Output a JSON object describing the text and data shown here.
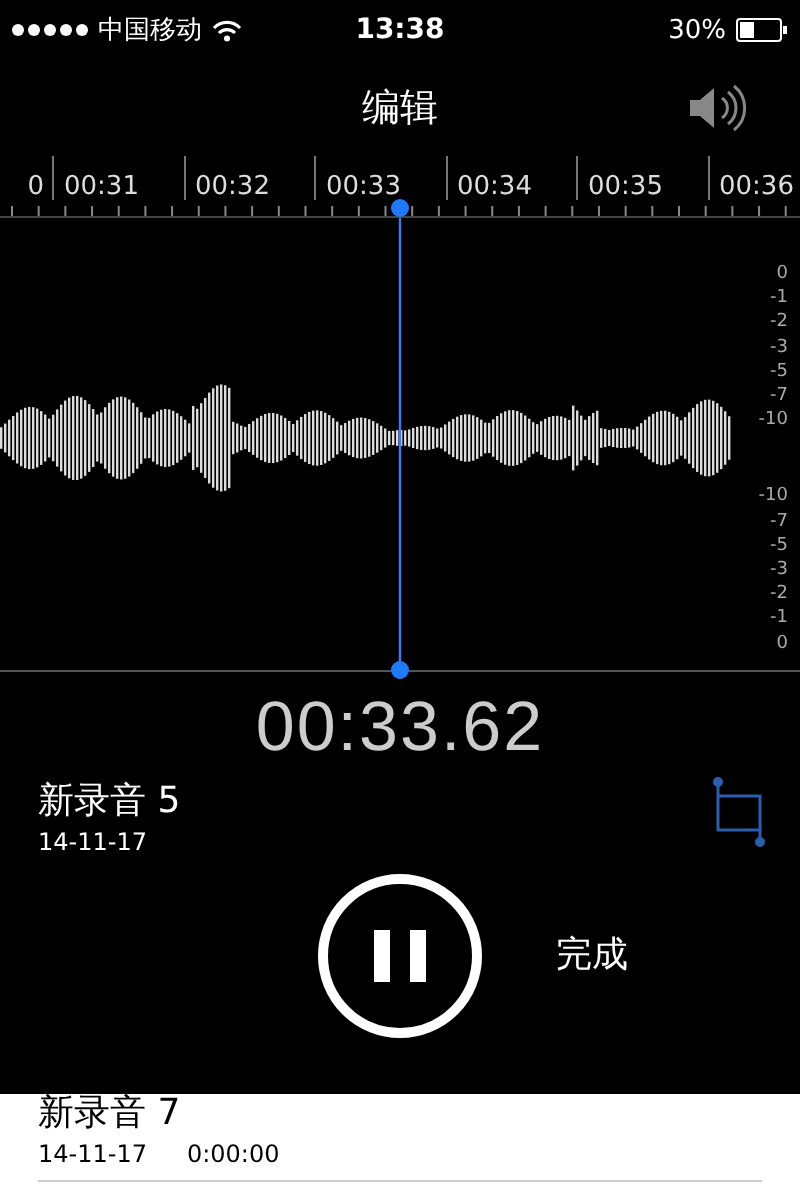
{
  "status_bar": {
    "carrier": "中国移动",
    "time": "13:38",
    "battery": "30%"
  },
  "nav": {
    "title": "编辑"
  },
  "ruler": {
    "labels": [
      "0",
      "00:31",
      "00:32",
      "00:33",
      "00:34",
      "00:35",
      "00:36"
    ]
  },
  "scale": {
    "labels": [
      "0",
      "-1",
      "-2",
      "-3",
      "-5",
      "-7",
      "-10",
      "-10",
      "-7",
      "-5",
      "-3",
      "-2",
      "-1",
      "0"
    ]
  },
  "playback": {
    "time": "00:33.62",
    "playing": true
  },
  "recording": {
    "name": "新录音 5",
    "date": "14-11-17"
  },
  "done_button": "完成",
  "list": [
    {
      "name": "新录音 7",
      "date": "14-11-17",
      "duration": "0:00:00"
    }
  ]
}
